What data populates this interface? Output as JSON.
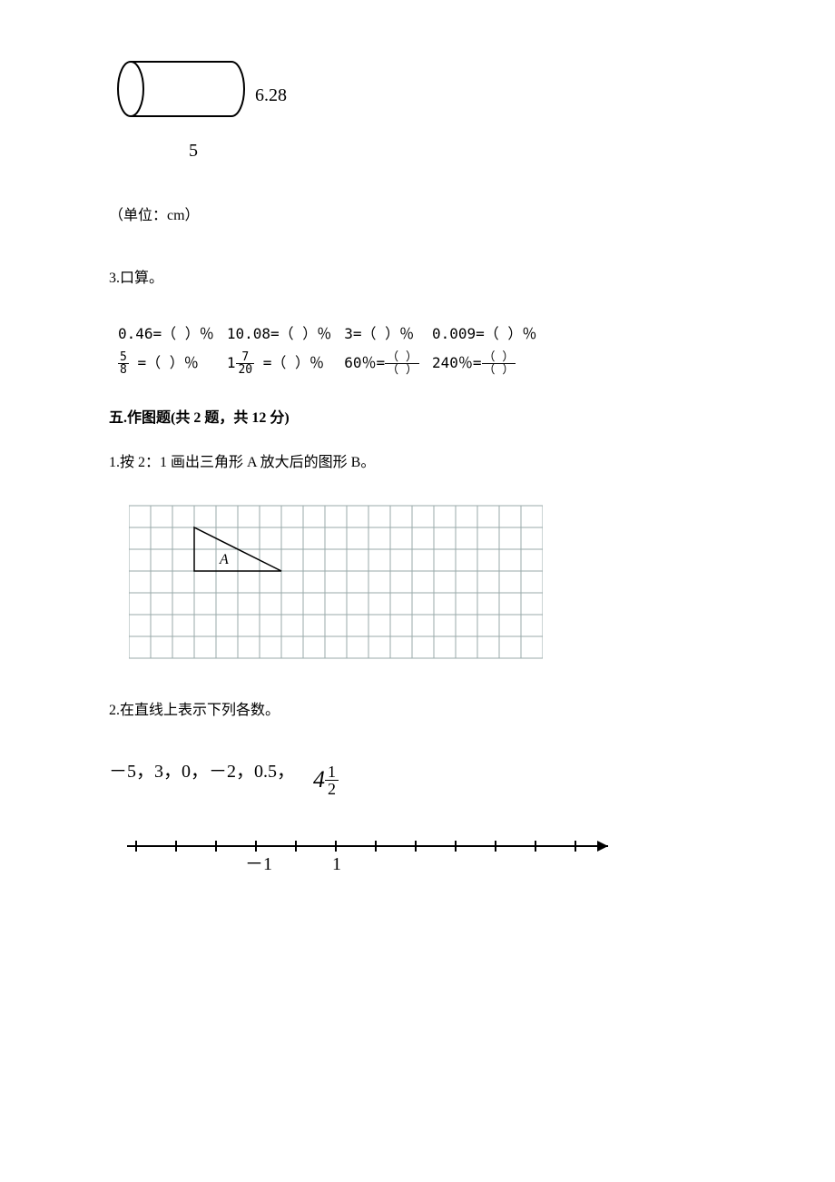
{
  "cylinder": {
    "height_label": "6.28",
    "width_label": "5",
    "unit_note": "（单位：cm）"
  },
  "q3": {
    "title": "3.口算。",
    "rows": [
      {
        "c1": "0.46=（  ）％",
        "c2": "10.08=（  ）％",
        "c3": "3=（  ）％",
        "c4": "0.009=（  ）％"
      },
      {
        "c1_frac": {
          "num": "5",
          "den": "8",
          "suffix": " =（  ）％"
        },
        "c2_mixed": {
          "int": "1",
          "num": "7",
          "den": "20",
          "suffix": " =（  ）％"
        },
        "c3_eq": {
          "lhs": "60％=",
          "num": "（ ）",
          "den": "（ ）"
        },
        "c4_eq": {
          "lhs": "240％=",
          "num": "（ ）",
          "den": "（ ）"
        }
      }
    ]
  },
  "section5": {
    "header": "五.作图题(共 2 题，共 12 分)",
    "q1": "1.按 2：1 画出三角形 A 放大后的图形 B。",
    "q2": "2.在直线上表示下列各数。",
    "numbers_prefix": "－5，3，0，－2，0.5，",
    "mixed": {
      "int": "4",
      "num": "1",
      "den": "2"
    },
    "numberline": {
      "left_label": "－1",
      "right_label": "1"
    },
    "triangle_label": "A"
  },
  "chart_data": [
    {
      "type": "diagram",
      "description": "cylinder side view",
      "length": 5,
      "diameter_label": 6.28,
      "unit": "cm"
    },
    {
      "type": "grid",
      "cols": 19,
      "rows": 7,
      "triangle_A": {
        "vertices_grid": [
          [
            3,
            1
          ],
          [
            3,
            3
          ],
          [
            7,
            3
          ]
        ],
        "label_cell": [
          4,
          2
        ]
      }
    },
    {
      "type": "numberline",
      "tick_start": -4,
      "tick_end": 7,
      "labeled_ticks": {
        "-1": "－1",
        "1": "1"
      },
      "values_to_plot": [
        -5,
        3,
        0,
        -2,
        0.5,
        4.5
      ]
    }
  ]
}
